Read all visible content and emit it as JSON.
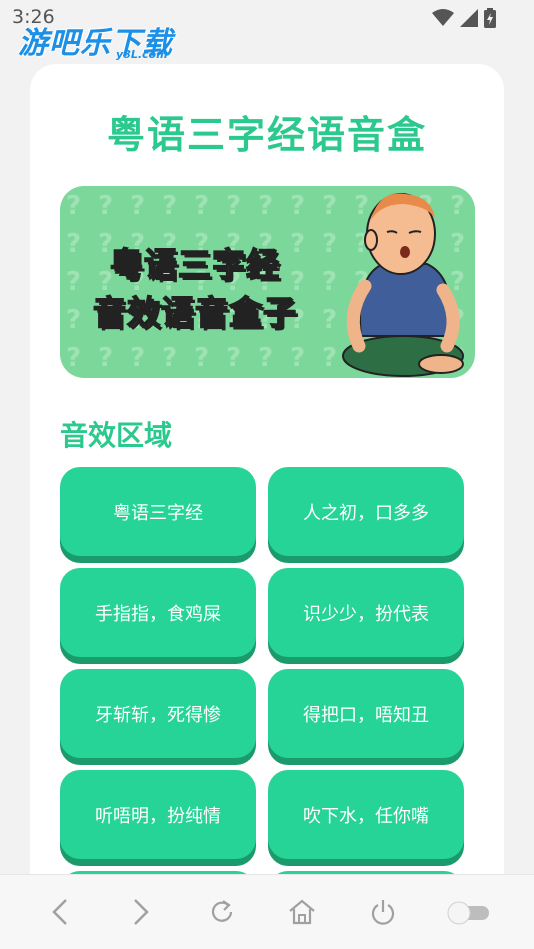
{
  "status_bar": {
    "time": "3:26"
  },
  "watermark": {
    "main": "游吧乐下载",
    "sub": "y8L.com"
  },
  "page": {
    "title": "粤语三字经语音盒"
  },
  "banner": {
    "line1": "粤语三字经",
    "line2": "音效语音盒子"
  },
  "section": {
    "title": "音效区域"
  },
  "sound_buttons": [
    "粤语三字经",
    "人之初，口多多",
    "手指指，食鸡屎",
    "识少少，扮代表",
    "牙斩斩，死得惨",
    "得把口，唔知丑",
    "听唔明，扮纯情",
    "吹下水，任你嘴",
    "",
    ""
  ],
  "colors": {
    "accent": "#2cc98f",
    "button": "#26d497",
    "button_shadow": "#1b9a6b",
    "banner_bg": "#7cd79a"
  },
  "bottom_nav": [
    "back-icon",
    "forward-icon",
    "refresh-icon",
    "home-icon",
    "power-icon",
    "toggle-switch"
  ]
}
